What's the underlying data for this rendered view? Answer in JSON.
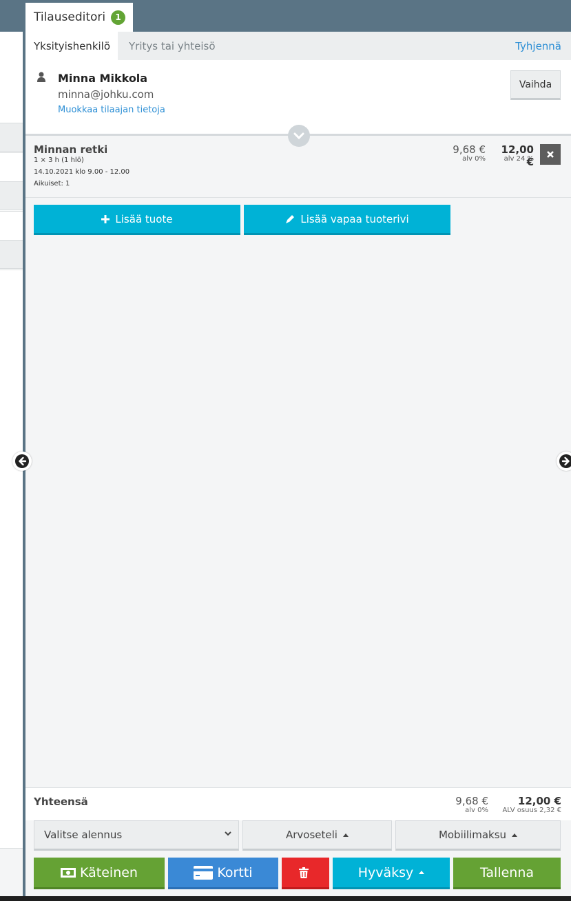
{
  "header": {
    "tab_label": "Tilauseditori",
    "badge_count": "1"
  },
  "customer_tabs": {
    "private": "Yksityishenkilö",
    "company": "Yritys tai yhteisö",
    "clear": "Tyhjennä"
  },
  "customer": {
    "name": "Minna Mikkola",
    "email": "minna@johku.com",
    "edit_link": "Muokkaa tilaajan tietoja",
    "change_button": "Vaihda"
  },
  "order_items": [
    {
      "name": "Minnan retki",
      "quantity": "1 × 3 h (1 hlö)",
      "datetime": "14.10.2021 klo 9.00 - 12.00",
      "participants": "Aikuiset: 1",
      "net_price": "9,68 €",
      "net_vat": "alv 0%",
      "gross_price": "12,00 €",
      "gross_vat": "alv 24 %"
    }
  ],
  "add_buttons": {
    "add_product": "Lisää tuote",
    "add_free_row": "Lisää vapaa tuoterivi"
  },
  "totals": {
    "label": "Yhteensä",
    "net": "9,68 €",
    "net_vat": "alv 0%",
    "gross": "12,00 €",
    "vat_share": "ALV osuus 2,32 €"
  },
  "options": {
    "discount_placeholder": "Valitse alennus",
    "voucher": "Arvoseteli",
    "mobile_payment": "Mobiilimaksu"
  },
  "actions": {
    "cash": "Käteinen",
    "card": "Kortti",
    "approve": "Hyväksy",
    "save": "Tallenna"
  },
  "colors": {
    "header": "#5a7485",
    "cyan": "#00b2d6",
    "green": "#65a234",
    "blue": "#3a89d6",
    "red": "#e8282a",
    "badge": "#62a434",
    "link": "#2d8fd5"
  },
  "icons": {
    "person": "person-icon",
    "expand": "chevron-down-icon",
    "remove": "close-icon",
    "add": "plus-icon",
    "edit": "pencil-icon",
    "cash": "banknote-icon",
    "card": "credit-card-icon",
    "delete": "trash-icon",
    "prev": "arrow-left-icon",
    "next": "arrow-right-icon"
  }
}
